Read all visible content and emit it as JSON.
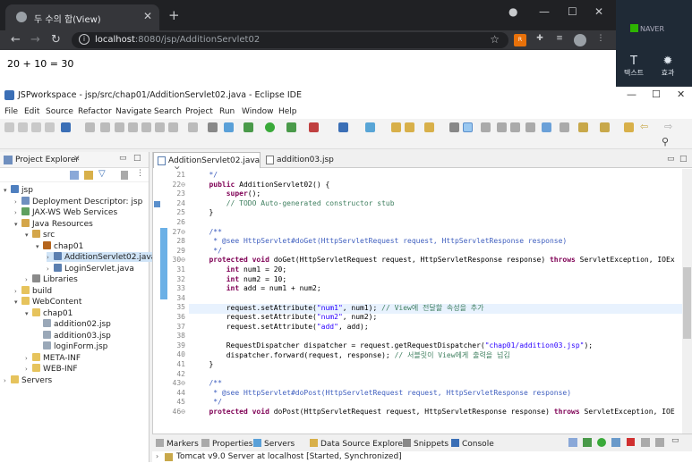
{
  "background_app": {
    "naver_label": "NAVER",
    "text_tool_label": "텍스트",
    "effect_tool_label": "효과"
  },
  "browser": {
    "tab_title": "두 수의 합(View)",
    "url_host": "localhost",
    "url_path": ":8080/jsp/AdditionServlet02",
    "page_text": "20 + 10 = 30"
  },
  "eclipse": {
    "window_title": "JSPworkspace - jsp/src/chap01/AdditionServlet02.java - Eclipse IDE",
    "menu": [
      "File",
      "Edit",
      "Source",
      "Refactor",
      "Navigate",
      "Search",
      "Project",
      "Run",
      "Window",
      "Help"
    ],
    "project_explorer": {
      "title": "Project Explorer",
      "items": [
        {
          "label": "jsp",
          "depth": 0,
          "arrow": "▾",
          "icon": "project",
          "color": "#4f7fbf"
        },
        {
          "label": "Deployment Descriptor: jsp",
          "depth": 1,
          "arrow": "›",
          "icon": "descriptor",
          "color": "#6f8fbf"
        },
        {
          "label": "JAX-WS Web Services",
          "depth": 1,
          "arrow": "›",
          "icon": "webservice",
          "color": "#5fa05f"
        },
        {
          "label": "Java Resources",
          "depth": 1,
          "arrow": "▾",
          "icon": "java-resources",
          "color": "#d4a64a"
        },
        {
          "label": "src",
          "depth": 2,
          "arrow": "▾",
          "icon": "source-folder",
          "color": "#d4a64a"
        },
        {
          "label": "chap01",
          "depth": 3,
          "arrow": "▾",
          "icon": "package",
          "color": "#b5651d"
        },
        {
          "label": "AdditionServlet02.java",
          "depth": 4,
          "arrow": "›",
          "icon": "java-file",
          "color": "#5b7fb0",
          "selected": true
        },
        {
          "label": "LoginServlet.java",
          "depth": 4,
          "arrow": "›",
          "icon": "java-file",
          "color": "#5b7fb0"
        },
        {
          "label": "Libraries",
          "depth": 2,
          "arrow": "›",
          "icon": "library",
          "color": "#8a8a8a"
        },
        {
          "label": "build",
          "depth": 1,
          "arrow": "›",
          "icon": "folder",
          "color": "#e6c35c"
        },
        {
          "label": "WebContent",
          "depth": 1,
          "arrow": "▾",
          "icon": "folder",
          "color": "#e6c35c"
        },
        {
          "label": "chap01",
          "depth": 2,
          "arrow": "▾",
          "icon": "folder",
          "color": "#e6c35c"
        },
        {
          "label": "addition02.jsp",
          "depth": 3,
          "arrow": "",
          "icon": "jsp-file",
          "color": "#9aa8b8"
        },
        {
          "label": "addition03.jsp",
          "depth": 3,
          "arrow": "",
          "icon": "jsp-file",
          "color": "#9aa8b8"
        },
        {
          "label": "loginForm.jsp",
          "depth": 3,
          "arrow": "",
          "icon": "jsp-file",
          "color": "#9aa8b8"
        },
        {
          "label": "META-INF",
          "depth": 2,
          "arrow": "›",
          "icon": "folder",
          "color": "#e6c35c"
        },
        {
          "label": "WEB-INF",
          "depth": 2,
          "arrow": "›",
          "icon": "folder",
          "color": "#e6c35c"
        },
        {
          "label": "Servers",
          "depth": 0,
          "arrow": "›",
          "icon": "folder",
          "color": "#e6c35c"
        }
      ]
    },
    "editor_tabs": [
      {
        "label": "AdditionServlet02.java",
        "active": true
      },
      {
        "label": "addition03.jsp",
        "active": false
      }
    ],
    "code_lines": [
      {
        "n": "21",
        "t": [
          {
            "c": "jd",
            "s": "   */"
          }
        ]
      },
      {
        "n": "22⊖",
        "t": [
          {
            "c": "kw",
            "s": "   public "
          },
          {
            "c": "",
            "s": "AdditionServlet02() {"
          }
        ]
      },
      {
        "n": "23",
        "t": [
          {
            "c": "kw",
            "s": "       super"
          },
          {
            "c": "",
            "s": "();"
          }
        ]
      },
      {
        "n": "24",
        "t": [
          {
            "c": "cm",
            "s": "       // TODO Auto-generated constructor stub"
          }
        ]
      },
      {
        "n": "25",
        "t": [
          {
            "c": "",
            "s": "   }"
          }
        ]
      },
      {
        "n": "26",
        "t": []
      },
      {
        "n": "27⊖",
        "t": [
          {
            "c": "jd",
            "s": "   /**"
          }
        ]
      },
      {
        "n": "28",
        "t": [
          {
            "c": "jd",
            "s": "    * @see HttpServlet#doGet(HttpServletRequest request, HttpServletResponse response)"
          }
        ]
      },
      {
        "n": "29",
        "t": [
          {
            "c": "jd",
            "s": "    */"
          }
        ]
      },
      {
        "n": "30⊖",
        "t": [
          {
            "c": "kw",
            "s": "   protected void "
          },
          {
            "c": "",
            "s": "doGet(HttpServletRequest request, HttpServletResponse response) "
          },
          {
            "c": "kw",
            "s": "throws "
          },
          {
            "c": "",
            "s": "ServletException, IOEx"
          }
        ]
      },
      {
        "n": "31",
        "t": [
          {
            "c": "kw",
            "s": "       int "
          },
          {
            "c": "",
            "s": "num1 = 20;"
          }
        ]
      },
      {
        "n": "32",
        "t": [
          {
            "c": "kw",
            "s": "       int "
          },
          {
            "c": "",
            "s": "num2 = 10;"
          }
        ]
      },
      {
        "n": "33",
        "t": [
          {
            "c": "kw",
            "s": "       int "
          },
          {
            "c": "",
            "s": "add = num1 + num2;"
          }
        ]
      },
      {
        "n": "34",
        "t": []
      },
      {
        "n": "35",
        "t": [
          {
            "c": "",
            "s": "       request.setAttribute("
          },
          {
            "c": "st",
            "s": "\"num1\""
          },
          {
            "c": "",
            "s": ", num1); "
          },
          {
            "c": "cm",
            "s": "// View에 전달할 속성을 추가"
          }
        ]
      },
      {
        "n": "36",
        "t": [
          {
            "c": "",
            "s": "       request.setAttribute("
          },
          {
            "c": "st",
            "s": "\"num2\""
          },
          {
            "c": "",
            "s": ", num2);"
          }
        ]
      },
      {
        "n": "37",
        "t": [
          {
            "c": "",
            "s": "       request.setAttribute("
          },
          {
            "c": "st",
            "s": "\"add\""
          },
          {
            "c": "",
            "s": ", add);"
          }
        ]
      },
      {
        "n": "38",
        "t": []
      },
      {
        "n": "39",
        "t": [
          {
            "c": "",
            "s": "       RequestDispatcher dispatcher = request.getRequestDispatcher("
          },
          {
            "c": "st",
            "s": "\"chap01/addition03.jsp\""
          },
          {
            "c": "",
            "s": ");"
          }
        ]
      },
      {
        "n": "40",
        "t": [
          {
            "c": "",
            "s": "       dispatcher.forward(request, response); "
          },
          {
            "c": "cm",
            "s": "// 서블릿이 View에게 출력을 넘김"
          }
        ]
      },
      {
        "n": "41",
        "t": [
          {
            "c": "",
            "s": "   }"
          }
        ]
      },
      {
        "n": "42",
        "t": []
      },
      {
        "n": "43⊖",
        "t": [
          {
            "c": "jd",
            "s": "   /**"
          }
        ]
      },
      {
        "n": "44",
        "t": [
          {
            "c": "jd",
            "s": "    * @see HttpServlet#doPost(HttpServletRequest request, HttpServletResponse response)"
          }
        ]
      },
      {
        "n": "45",
        "t": [
          {
            "c": "jd",
            "s": "    */"
          }
        ]
      },
      {
        "n": "46⊖",
        "t": [
          {
            "c": "kw",
            "s": "   protected void "
          },
          {
            "c": "",
            "s": "doPost(HttpServletRequest request, HttpServletResponse response) "
          },
          {
            "c": "kw",
            "s": "throws "
          },
          {
            "c": "",
            "s": "ServletException, IOE"
          }
        ]
      }
    ],
    "bottom_tabs": [
      "Markers",
      "Properties",
      "Servers",
      "Data Source Explorer",
      "Snippets",
      "Console"
    ],
    "server_row": "Tomcat v9.0 Server at localhost  [Started, Synchronized]",
    "colors": {
      "keyword": "#7f0055",
      "comment": "#3f7f5f",
      "javadoc": "#3f5fbf",
      "string": "#2a00ff",
      "selection": "#d0e4f7"
    }
  }
}
